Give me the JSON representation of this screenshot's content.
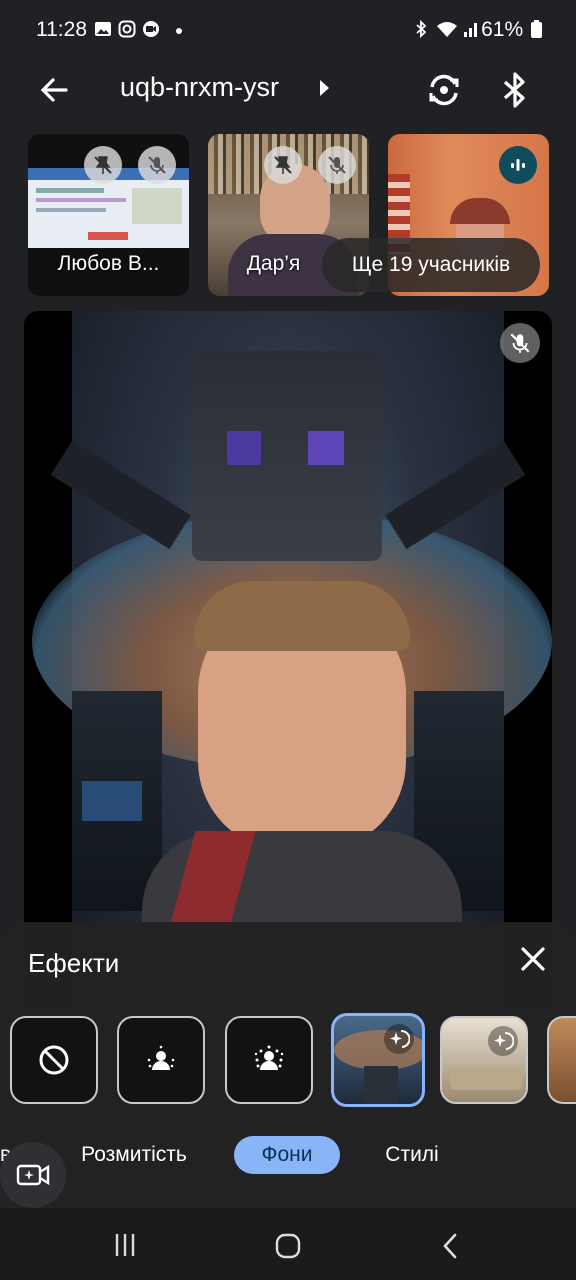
{
  "status_bar": {
    "time": "11:28",
    "battery": "61%"
  },
  "top_bar": {
    "meeting_code": "uqb-nrxm-ysr"
  },
  "tiles": [
    {
      "name": "Любов В..."
    },
    {
      "name": "Дар’я"
    },
    {
      "more_label": "Ще 19 учасників"
    }
  ],
  "effects": {
    "title": "Ефекти",
    "tabs": {
      "partial": "в",
      "layout": "Розмитість",
      "backgrounds": "Фони",
      "styles": "Стилі"
    }
  },
  "colors": {
    "accent": "#8ab4f8",
    "background": "#202124",
    "speaking": "#0f4c5c"
  }
}
